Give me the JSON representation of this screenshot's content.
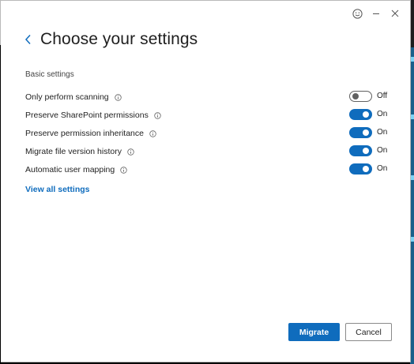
{
  "window_controls": {
    "feedback_icon": "smiley-icon",
    "minimize_icon": "minimize-icon",
    "close_icon": "close-icon"
  },
  "header": {
    "back_icon": "chevron-left-icon",
    "title": "Choose your settings"
  },
  "section": {
    "label": "Basic settings"
  },
  "settings": [
    {
      "label": "Only perform scanning",
      "state": "Off",
      "enabled": false
    },
    {
      "label": "Preserve SharePoint permissions",
      "state": "On",
      "enabled": true
    },
    {
      "label": "Preserve permission inheritance",
      "state": "On",
      "enabled": true
    },
    {
      "label": "Migrate file version history",
      "state": "On",
      "enabled": true
    },
    {
      "label": "Automatic user mapping",
      "state": "On",
      "enabled": true
    }
  ],
  "view_all_link": "View all settings",
  "footer": {
    "primary_label": "Migrate",
    "secondary_label": "Cancel"
  },
  "colors": {
    "accent": "#0f6cbd",
    "toggle_off_border": "#616161"
  }
}
